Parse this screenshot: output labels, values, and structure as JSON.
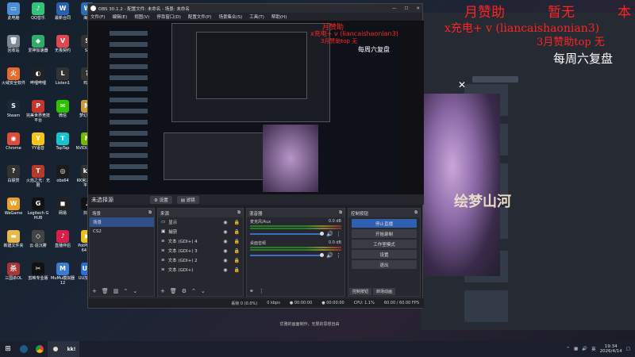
{
  "overlays": {
    "sponsor_month": "月赞助",
    "sponsor_none": "暂无",
    "sponsor_ben": "本",
    "charge_line": "x充电+ v (liancaishaonian3)",
    "top_line": "3月赞助top  无",
    "weekly": "每周六复盘"
  },
  "desktop_icons": [
    {
      "label": "此电脑",
      "color": "#4a90d9",
      "glyph": "▭"
    },
    {
      "label": "QQ音乐",
      "color": "#31c27c",
      "glyph": "♪"
    },
    {
      "label": "最新合同",
      "color": "#2b5fb4",
      "glyph": "W"
    },
    {
      "label": "海豚",
      "color": "#2a6db5",
      "glyph": "W"
    },
    {
      "label": "回收站",
      "color": "#7a8896",
      "glyph": "🗑"
    },
    {
      "label": "爱神加速器",
      "color": "#2fae6a",
      "glyph": "◆"
    },
    {
      "label": "无畏契约",
      "color": "#e0484f",
      "glyph": "V"
    },
    {
      "label": "ST",
      "color": "#333",
      "glyph": "S"
    },
    {
      "label": "火绒安全软件",
      "color": "#e86a2a",
      "glyph": "火"
    },
    {
      "label": "哔哩哔哩",
      "color": "#222",
      "glyph": "◐"
    },
    {
      "label": "Listen1",
      "color": "#333",
      "glyph": "L"
    },
    {
      "label": "鸡菜",
      "color": "#333",
      "glyph": "?"
    },
    {
      "label": "Steam",
      "color": "#1b2838",
      "glyph": "S"
    },
    {
      "label": "完美世界竞技平台",
      "color": "#c6342e",
      "glyph": "P"
    },
    {
      "label": "微信",
      "color": "#2dc100",
      "glyph": "✉"
    },
    {
      "label": "梦幻西游",
      "color": "#c99a3a",
      "glyph": "M"
    },
    {
      "label": "Chrome",
      "color": "#dd4b39",
      "glyph": "◉"
    },
    {
      "label": "YY语音",
      "color": "#f5c518",
      "glyph": "Y"
    },
    {
      "label": "TapTap",
      "color": "#15c5ce",
      "glyph": "T"
    },
    {
      "label": "NVIDIA App",
      "color": "#76b900",
      "glyph": "N"
    },
    {
      "label": "白嫖赏",
      "color": "#333",
      "glyph": "?"
    },
    {
      "label": "火焰之光：无限",
      "color": "#b53a2a",
      "glyph": "T"
    },
    {
      "label": "obs64",
      "color": "#1b1b1b",
      "glyph": "◎"
    },
    {
      "label": "KK官方对战平台",
      "color": "#333",
      "glyph": "kk"
    },
    {
      "label": "WeGame",
      "color": "#e8a02a",
      "glyph": "W"
    },
    {
      "label": "Logitech G HUB",
      "color": "#111",
      "glyph": "G"
    },
    {
      "label": "网易",
      "color": "#222",
      "glyph": "◼"
    },
    {
      "label": "抖音",
      "color": "#111",
      "glyph": "♪"
    },
    {
      "label": "新建文件夹",
      "color": "#e8b84a",
      "glyph": "▬"
    },
    {
      "label": "云·造沉雾",
      "color": "#444",
      "glyph": "◇"
    },
    {
      "label": "直播伴侣",
      "color": "#d6204c",
      "glyph": "♪"
    },
    {
      "label": "PotPlayer 64 bit",
      "color": "#e6c21a",
      "glyph": "▶"
    },
    {
      "label": "三国杀OL",
      "color": "#a33",
      "glyph": "杀"
    },
    {
      "label": "剪映专业版",
      "color": "#111",
      "glyph": "✂"
    },
    {
      "label": "MuMu模拟器12",
      "color": "#3a7bd5",
      "glyph": "M"
    },
    {
      "label": "UU加速器",
      "color": "#2a6de0",
      "glyph": "UU"
    }
  ],
  "obs": {
    "title": "OBS 30.1.2 - 配置文件: 未命名 - 场景: 未命名",
    "win_min": "—",
    "win_max": "☐",
    "win_close": "✕",
    "menu": [
      "文件(F)",
      "编辑(E)",
      "视图(V)",
      "停靠窗口(D)",
      "配置文件(P)",
      "场景集合(S)",
      "工具(T)",
      "帮助(H)"
    ],
    "no_source": "未选择源",
    "props_btn": "设置",
    "filters_btn": "滤镜",
    "scenes_title": "场景",
    "scenes": [
      "场景",
      "CS2"
    ],
    "sources_title": "来源",
    "sources": [
      "显示",
      "捕获",
      "文本 (GDI+) 4",
      "文本 (GDI+) 3",
      "文本 (GDI+) 2",
      "文本 (GDI+)"
    ],
    "mixer_title": "混音器",
    "mixer": [
      {
        "name": "麦克风/Aux",
        "db": "0.0 dB"
      },
      {
        "name": "桌面音频",
        "db": "0.0 dB"
      }
    ],
    "controls_title": "控制按钮",
    "controls": [
      "停止直播",
      "开始录制",
      "工作室模式",
      "设置",
      "退出"
    ],
    "tabs": [
      "控制按钮",
      "转场动画"
    ],
    "status": {
      "dropped": "丢帧 0 (0.0%)",
      "kbps": "0 kbps",
      "rec_time": "00:00:00",
      "live_time": "00:00:00",
      "cpu": "CPU: 1.1%",
      "fps": "60.00 / 60.00 FPS"
    }
  },
  "browser": {
    "close_x": "✕",
    "calligraphy": "绘梦山河",
    "card_text": "优雅的画面制作，无限的思想自由"
  },
  "taskbar": {
    "apps": [
      "⊞",
      "Steam",
      "Chrome",
      "OBS",
      "KK"
    ],
    "lang": "英",
    "time": "19:34",
    "date": "2026/4/14"
  }
}
